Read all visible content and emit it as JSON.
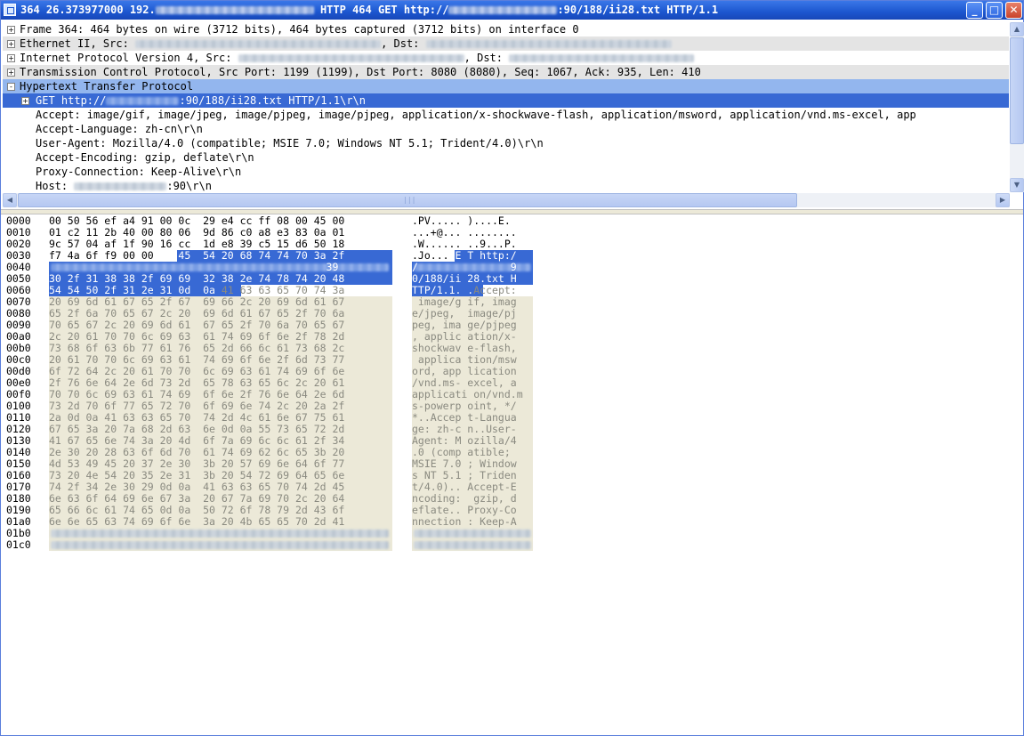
{
  "window": {
    "title_prefix": "364 26.373977000 192.",
    "title_suffix": "HTTP 464 GET http://",
    "title_url_tail": ":90/188/ii28.txt HTTP/1.1",
    "buttons": {
      "minimize": "_",
      "maximize": "□",
      "close": "✕"
    }
  },
  "tree": {
    "frame": "Frame 364: 464 bytes on wire (3712 bits), 464 bytes captured (3712 bits) on interface 0",
    "ethernet_prefix": "Ethernet II, Src:",
    "ethernet_dst": ", Dst:",
    "ip_prefix": "Internet Protocol Version 4, Src:",
    "ip_dst": ", Dst:",
    "tcp": "Transmission Control Protocol, Src Port: 1199 (1199), Dst Port: 8080 (8080), Seq: 1067, Ack: 935, Len: 410",
    "http": "Hypertext Transfer Protocol",
    "get_prefix": "GET http://",
    "get_suffix": ":90/188/ii28.txt HTTP/1.1\\r\\n",
    "accept": "Accept: image/gif, image/jpeg, image/pjpeg, image/pjpeg, application/x-shockwave-flash, application/msword, application/vnd.ms-excel, app",
    "accept_language": "Accept-Language: zh-cn\\r\\n",
    "user_agent": "User-Agent: Mozilla/4.0 (compatible; MSIE 7.0; Windows NT 5.1; Trident/4.0)\\r\\n",
    "accept_encoding": "Accept-Encoding: gzip, deflate\\r\\n",
    "proxy_connection": "Proxy-Connection: Keep-Alive\\r\\n",
    "host_prefix": "Host:",
    "host_suffix": ":90\\r\\n",
    "expand_symbol": "+",
    "collapse_symbol": "-"
  },
  "hex": {
    "offsets": [
      "0000",
      "0010",
      "0020",
      "0030",
      "0040",
      "0050",
      "0060",
      "0070",
      "0080",
      "0090",
      "00a0",
      "00b0",
      "00c0",
      "00d0",
      "00e0",
      "00f0",
      "0100",
      "0110",
      "0120",
      "0130",
      "0140",
      "0150",
      "0160",
      "0170",
      "0180",
      "0190",
      "01a0",
      "01b0",
      "01c0"
    ],
    "rows": [
      {
        "a": "00 50 56 ef a4 91 00 0c",
        "b": "29 e4 cc ff 08 00 45 00",
        "ta": ".PV.....",
        "tb": ")....E."
      },
      {
        "a": "01 c2 11 2b 40 00 80 06",
        "b": "9d 86 c0 a8 e3 83 0a 01",
        "ta": "...+@...",
        "tb": "........"
      },
      {
        "a": "9c 57 04 af 1f 90 16 cc",
        "b": "1d e8 39 c5 15 d6 50 18",
        "ta": ".W......",
        "tb": "..9...P."
      },
      {
        "a": "f7 4a 6f f9 00 00",
        "as": "47 45",
        "b": "54 20 68 74 74 70 3a 2f",
        "ta": ".Jo...",
        "tas": "GE",
        "tb": "T http:/"
      },
      {
        "a": "",
        "b": "39",
        "ta": "/",
        "tb": "9"
      },
      {
        "a": "30 2f 31 38 38 2f 69 69",
        "b": "32 38 2e 74 78 74 20 48",
        "ta": "0/188/ii",
        "tb": "28.txt H"
      },
      {
        "a": "54 54 50 2f 31 2e 31 0d",
        "b": "0a",
        "bd": " 41 63 63 65 70 74 3a",
        "ta": "TTP/1.1.",
        "tb": ".",
        "tbd": "Accept:"
      },
      {
        "a": "20 69 6d 61 67 65 2f 67",
        "b": "69 66 2c 20 69 6d 61 67",
        "ta": " image/g",
        "tb": "if, imag"
      },
      {
        "a": "65 2f 6a 70 65 67 2c 20",
        "b": "69 6d 61 67 65 2f 70 6a",
        "ta": "e/jpeg, ",
        "tb": "image/pj"
      },
      {
        "a": "70 65 67 2c 20 69 6d 61",
        "b": "67 65 2f 70 6a 70 65 67",
        "ta": "peg, ima",
        "tb": "ge/pjpeg"
      },
      {
        "a": "2c 20 61 70 70 6c 69 63",
        "b": "61 74 69 6f 6e 2f 78 2d",
        "ta": ", applic",
        "tb": "ation/x-"
      },
      {
        "a": "73 68 6f 63 6b 77 61 76",
        "b": "65 2d 66 6c 61 73 68 2c",
        "ta": "shockwav",
        "tb": "e-flash,"
      },
      {
        "a": "20 61 70 70 6c 69 63 61",
        "b": "74 69 6f 6e 2f 6d 73 77",
        "ta": " applica",
        "tb": "tion/msw"
      },
      {
        "a": "6f 72 64 2c 20 61 70 70",
        "b": "6c 69 63 61 74 69 6f 6e",
        "ta": "ord, app",
        "tb": "lication"
      },
      {
        "a": "2f 76 6e 64 2e 6d 73 2d",
        "b": "65 78 63 65 6c 2c 20 61",
        "ta": "/vnd.ms-",
        "tb": "excel, a"
      },
      {
        "a": "70 70 6c 69 63 61 74 69",
        "b": "6f 6e 2f 76 6e 64 2e 6d",
        "ta": "applicati",
        "tb": "on/vnd.m"
      },
      {
        "a": "73 2d 70 6f 77 65 72 70",
        "b": "6f 69 6e 74 2c 20 2a 2f",
        "ta": "s-powerp",
        "tb": "oint, */"
      },
      {
        "a": "2a 0d 0a 41 63 63 65 70",
        "b": "74 2d 4c 61 6e 67 75 61",
        "ta": "*..Accep",
        "tb": "t-Langua"
      },
      {
        "a": "67 65 3a 20 7a 68 2d 63",
        "b": "6e 0d 0a 55 73 65 72 2d",
        "ta": "ge: zh-c",
        "tb": "n..User-"
      },
      {
        "a": "41 67 65 6e 74 3a 20 4d",
        "b": "6f 7a 69 6c 6c 61 2f 34",
        "ta": "Agent: M",
        "tb": "ozilla/4"
      },
      {
        "a": "2e 30 20 28 63 6f 6d 70",
        "b": "61 74 69 62 6c 65 3b 20",
        "ta": ".0 (comp",
        "tb": "atible; "
      },
      {
        "a": "4d 53 49 45 20 37 2e 30",
        "b": "3b 20 57 69 6e 64 6f 77",
        "ta": "MSIE 7.0",
        "tb": "; Window"
      },
      {
        "a": "73 20 4e 54 20 35 2e 31",
        "b": "3b 20 54 72 69 64 65 6e",
        "ta": "s NT 5.1",
        "tb": "; Triden"
      },
      {
        "a": "74 2f 34 2e 30 29 0d 0a",
        "b": "41 63 63 65 70 74 2d 45",
        "ta": "t/4.0)..",
        "tb": "Accept-E"
      },
      {
        "a": "6e 63 6f 64 69 6e 67 3a",
        "b": "20 67 7a 69 70 2c 20 64",
        "ta": "ncoding:",
        "tb": " gzip, d"
      },
      {
        "a": "65 66 6c 61 74 65 0d 0a",
        "b": "50 72 6f 78 79 2d 43 6f",
        "ta": "eflate..",
        "tb": "Proxy-Co"
      },
      {
        "a": "6e 6e 65 63 74 69 6f 6e",
        "b": "3a 20 4b 65 65 70 2d 41",
        "ta": "nnection",
        "tb": ": Keep-A"
      },
      {
        "a": "",
        "b": "",
        "ta": "",
        "tb": ""
      },
      {
        "a": "",
        "b": "",
        "ta": "",
        "tb": ""
      }
    ]
  }
}
